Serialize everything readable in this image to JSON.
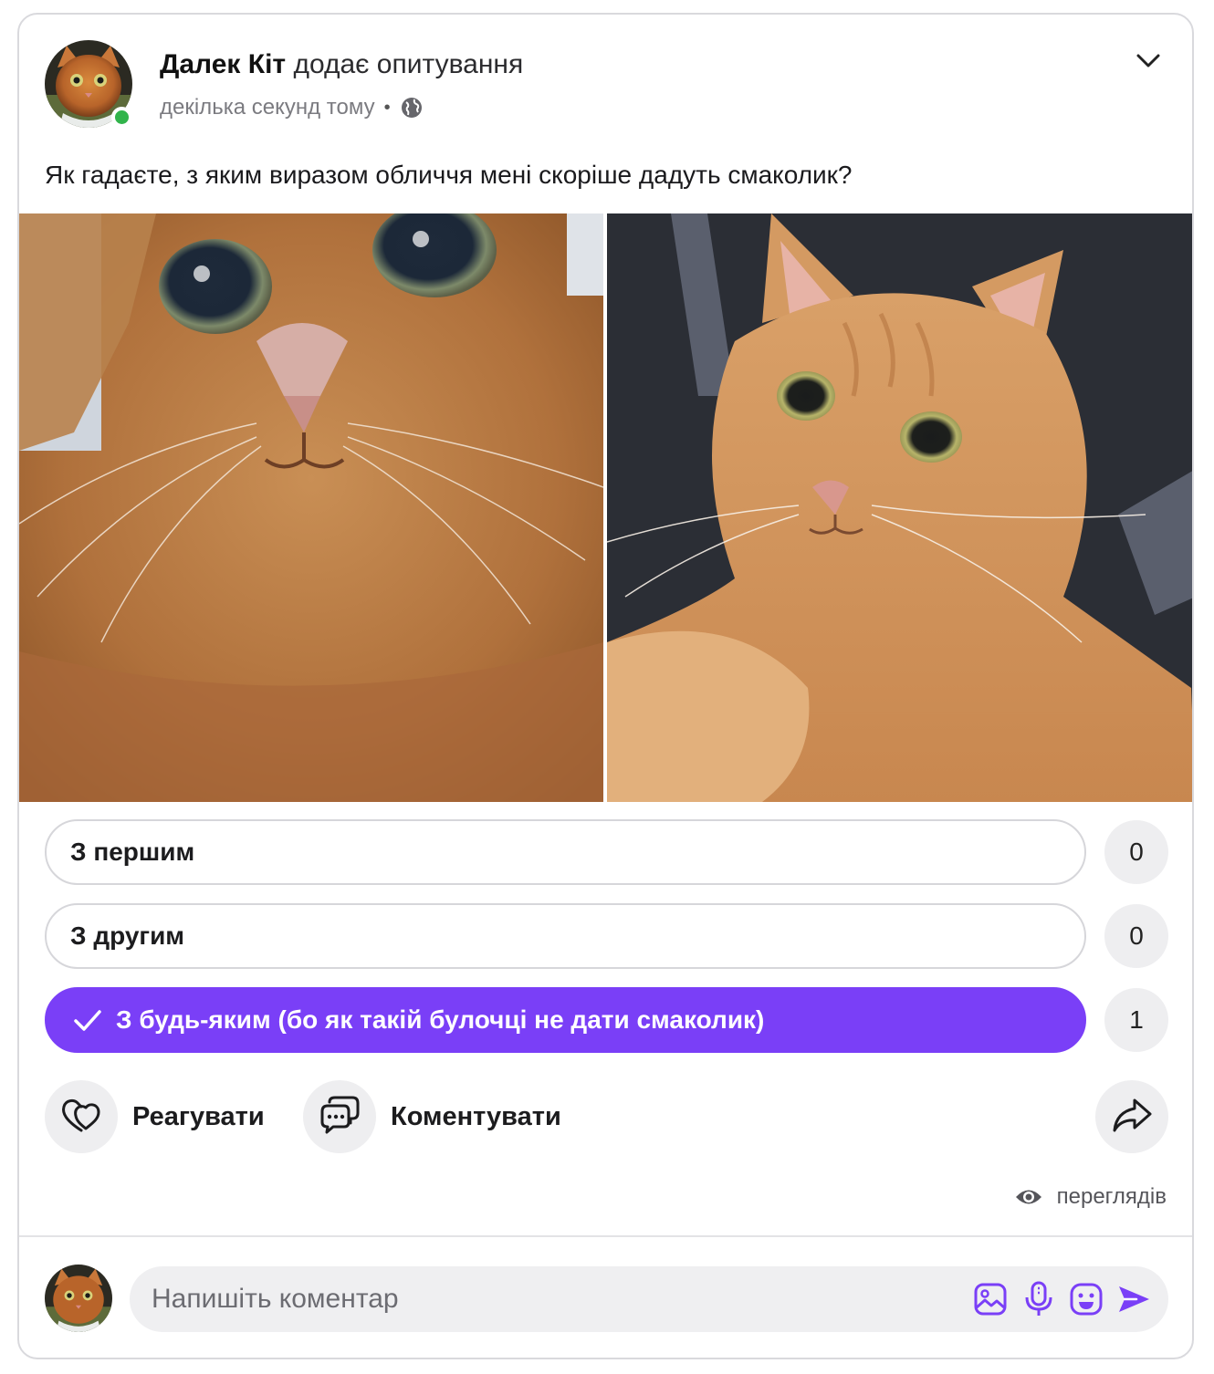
{
  "post": {
    "author_name": "Далек Кіт",
    "author_action": "додає опитування",
    "time": "декілька секунд тому",
    "separator": "•",
    "text": "Як гадаєте, з яким виразом обличчя мені скоріше дадуть смаколик?"
  },
  "poll": {
    "options": [
      {
        "label": "З першим",
        "count": "0",
        "selected": false
      },
      {
        "label": "З другим",
        "count": "0",
        "selected": false
      },
      {
        "label": "З будь-яким (бо як такій булочці не дати смаколик)",
        "count": "1",
        "selected": true
      }
    ]
  },
  "actions": {
    "react_label": "Реагувати",
    "comment_label": "Коментувати"
  },
  "views": {
    "label": "переглядів"
  },
  "comment": {
    "placeholder": "Напишіть коментар"
  },
  "colors": {
    "accent": "#7a3ff7",
    "online": "#31b44b",
    "pill_bg": "#eeeef0"
  },
  "icons": [
    "chevron-down-icon",
    "globe-icon",
    "check-icon",
    "heart-react-icon",
    "chat-bubbles-icon",
    "share-arrow-icon",
    "eye-icon",
    "image-icon",
    "microphone-icon",
    "emoji-icon",
    "send-icon"
  ]
}
